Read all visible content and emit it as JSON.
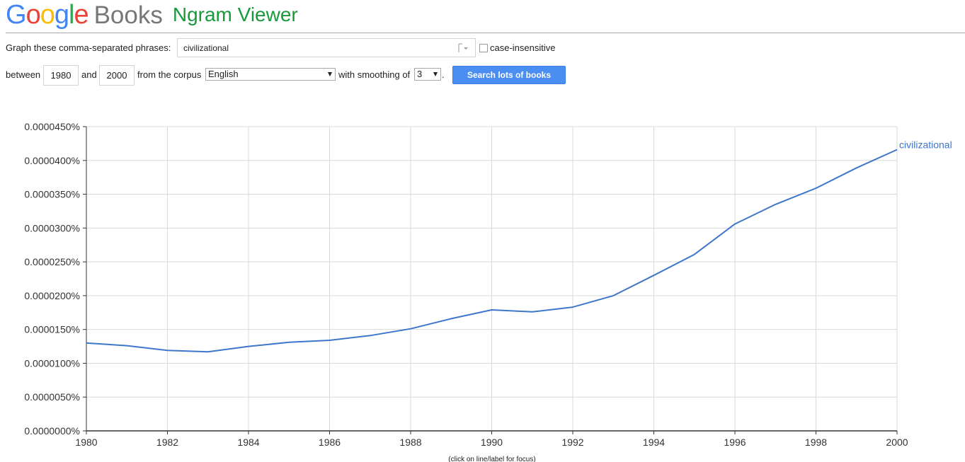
{
  "header": {
    "logo_letters": [
      {
        "char": "G",
        "color": "#4285F4"
      },
      {
        "char": "o",
        "color": "#EA4335"
      },
      {
        "char": "o",
        "color": "#FBBC05"
      },
      {
        "char": "g",
        "color": "#4285F4"
      },
      {
        "char": "l",
        "color": "#34A853"
      },
      {
        "char": "e",
        "color": "#EA4335"
      }
    ],
    "books": "Books",
    "title": "Ngram Viewer"
  },
  "query": {
    "phrases_label": "Graph these comma-separated phrases:",
    "phrases_value": "civilizational",
    "case_insensitive_label": "case-insensitive",
    "case_insensitive_checked": false,
    "between_label": "between",
    "year_start": "1980",
    "and_label": "and",
    "year_end": "2000",
    "corpus_label": "from the corpus",
    "corpus_value": "English",
    "smoothing_label": "with smoothing of",
    "smoothing_value": "3",
    "period": ".",
    "search_button": "Search lots of books"
  },
  "chart_data": {
    "type": "line",
    "x": [
      1980,
      1981,
      1982,
      1983,
      1984,
      1985,
      1986,
      1987,
      1988,
      1989,
      1990,
      1991,
      1992,
      1993,
      1994,
      1995,
      1996,
      1997,
      1998,
      1999,
      2000
    ],
    "series": [
      {
        "name": "civilizational",
        "color": "#3d76cb",
        "values": [
          1.3e-05,
          1.26e-05,
          1.19e-05,
          1.17e-05,
          1.25e-05,
          1.31e-05,
          1.34e-05,
          1.41e-05,
          1.51e-05,
          1.66e-05,
          1.79e-05,
          1.76e-05,
          1.83e-05,
          2e-05,
          2.3e-05,
          2.61e-05,
          3.06e-05,
          3.35e-05,
          3.59e-05,
          3.89e-05,
          4.16e-05
        ]
      }
    ],
    "ylim": [
      0,
      4.5e-05
    ],
    "yticks": [
      0,
      5e-06,
      1e-05,
      1.5e-05,
      2e-05,
      2.5e-05,
      3e-05,
      3.5e-05,
      4e-05,
      4.5e-05
    ],
    "ytick_labels": [
      "0.0000000%",
      "0.0000050%",
      "0.0000100%",
      "0.0000150%",
      "0.0000200%",
      "0.0000250%",
      "0.0000300%",
      "0.0000350%",
      "0.0000400%",
      "0.0000450%"
    ],
    "xlim": [
      1980,
      2000
    ],
    "xticks": [
      1980,
      1982,
      1984,
      1986,
      1988,
      1990,
      1992,
      1994,
      1996,
      1998,
      2000
    ],
    "xtick_labels": [
      "1980",
      "1982",
      "1984",
      "1986",
      "1988",
      "1990",
      "1992",
      "1994",
      "1996",
      "1998",
      "2000"
    ],
    "grid": true,
    "hint": "(click on line/label for focus)"
  }
}
